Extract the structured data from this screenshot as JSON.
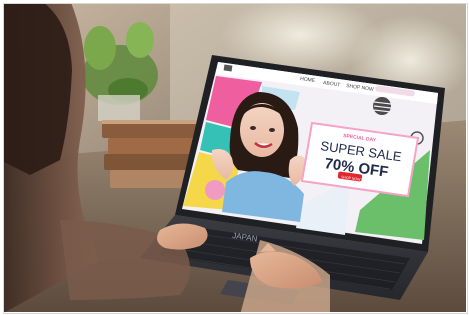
{
  "image": {
    "scene": "photo-laptop-sale-website"
  },
  "website": {
    "nav_items": [
      "HOME",
      "ABOUT",
      "SHOP NOW"
    ],
    "promo_small": "SPECIAL DAY",
    "promo_title": "SUPER SALE",
    "promo_discount": "70% OFF",
    "promo_button": "SHOP NOW"
  },
  "laptop": {
    "brand": "JAPAN"
  },
  "colors": {
    "screen_bg": "#f4f1f6",
    "pink": "#ef5fa0",
    "teal": "#35c1b5",
    "green": "#6bbf6a",
    "yellow": "#f5d84a",
    "red_button": "#e1262e",
    "laptop_body": "#2f3036"
  }
}
